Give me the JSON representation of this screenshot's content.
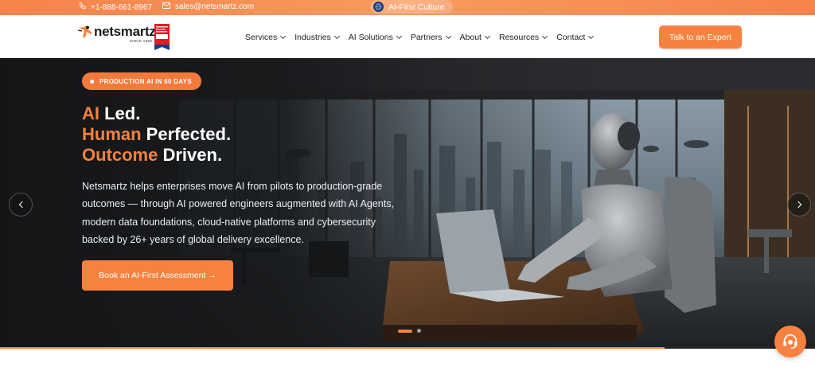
{
  "topbar": {
    "phone": "+1-888-661-8967",
    "email": "sales@netsmartz.com",
    "culture_label": "AI-First Culture"
  },
  "nav": {
    "logo_text": "netsmartz",
    "logo_since": "SINCE 1999",
    "items": [
      {
        "label": "Services"
      },
      {
        "label": "Industries"
      },
      {
        "label": "AI Solutions"
      },
      {
        "label": "Partners"
      },
      {
        "label": "About"
      },
      {
        "label": "Resources"
      },
      {
        "label": "Contact"
      }
    ],
    "cta_label": "Talk to an Expert"
  },
  "hero": {
    "pill_label": "PRODUCTION AI IN 60 DAYS",
    "headline": [
      {
        "accent": "AI",
        "rest": " Led."
      },
      {
        "accent": "Human",
        "rest": " Perfected."
      },
      {
        "accent": "Outcome",
        "rest": " Driven."
      }
    ],
    "description": "Netsmartz helps enterprises move AI from pilots to production-grade outcomes — through AI powered engineers augmented with AI Agents, modern data foundations, cloud-native platforms and cybersecurity backed by 26+ years of global delivery excellence.",
    "button_label": "Book an AI-First Assessment →",
    "slides_total": 2,
    "slide_active": 1
  },
  "colors": {
    "accent": "#f7823f",
    "topbar": "#f6834a",
    "text_dark": "#222222"
  },
  "icons": [
    "phone-icon",
    "mail-icon",
    "globe-icon",
    "chevron-down-icon",
    "chevron-left-icon",
    "chevron-right-icon",
    "support-headset-icon"
  ]
}
